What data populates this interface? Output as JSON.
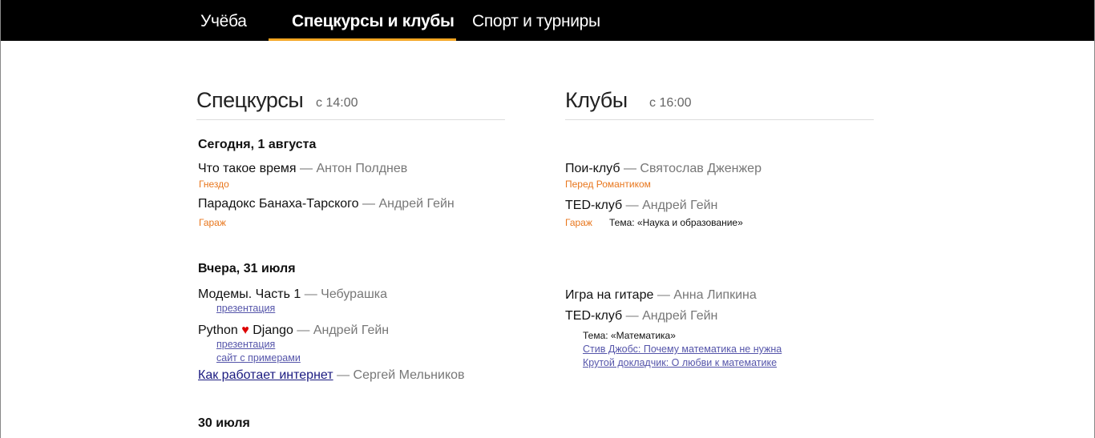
{
  "nav": {
    "tabs": [
      {
        "label": "Учёба"
      },
      {
        "label": "Спецкурсы и клубы"
      },
      {
        "label": "Спорт и турниры"
      }
    ]
  },
  "courses": {
    "title": "Спецкурсы",
    "time": "с 14:00",
    "days": [
      {
        "date": "Сегодня, 1 августа",
        "items": [
          {
            "title": "Что такое время",
            "author": "— Антон Полднев",
            "place": "Гнездо"
          },
          {
            "title": "Парадокс Банаха-Тарского",
            "author": "— Андрей Гейн",
            "place": "Гараж"
          }
        ]
      },
      {
        "date": "Вчера, 31 июля",
        "items": [
          {
            "title": "Модемы. Часть 1",
            "author": "— Чебурашка",
            "links": [
              "презентация"
            ]
          },
          {
            "title_pre": "Python",
            "heart": "♥",
            "title_post": "Django",
            "author": "— Андрей Гейн",
            "links": [
              "презентация",
              "сайт с примерами"
            ]
          },
          {
            "title": "Как работает интернет",
            "author": "— Сергей Мельников"
          }
        ]
      },
      {
        "date": "30 июля"
      }
    ]
  },
  "clubs": {
    "title": "Клубы",
    "time": "с 16:00",
    "days": [
      {
        "items": [
          {
            "title": "Пои-клуб",
            "author": "— Святослав Дженжер",
            "place": "Перед Романтиком"
          },
          {
            "title": "TED-клуб",
            "author": "— Андрей Гейн",
            "place": "Гараж",
            "topic": "Тема: «Наука и образование»"
          }
        ]
      },
      {
        "items": [
          {
            "title": "Игра на гитаре",
            "author": "— Анна Липкина"
          },
          {
            "title": "TED-клуб",
            "author": "— Андрей Гейн",
            "topic": "Тема: «Математика»",
            "links": [
              "Стив Джобс: Почему математика не нужна",
              "Крутой докладчик: О любви к математике"
            ]
          }
        ]
      }
    ]
  }
}
